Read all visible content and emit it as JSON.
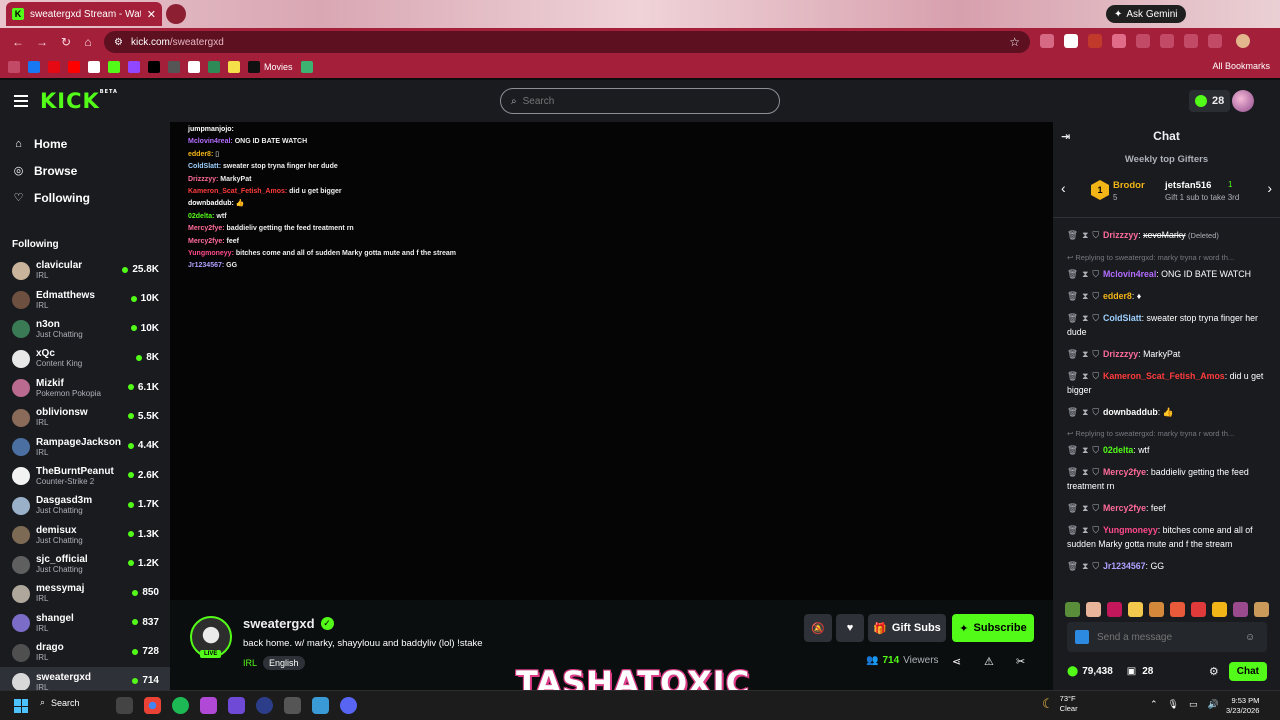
{
  "browser": {
    "tab_title": "sweatergxd Stream - Watch Live",
    "tab_close": "✕",
    "gemini_label": "Ask Gemini",
    "url_host": "kick.com",
    "url_path": "/sweatergxd",
    "bookmark_movies": "Movies",
    "all_bookmarks": "All Bookmarks"
  },
  "header": {
    "logo": "KICK",
    "logo_badge": "BETA",
    "search_placeholder": "Search",
    "kicks_count": "28"
  },
  "sidebar": {
    "nav": [
      {
        "label": "Home",
        "icon": "⌂"
      },
      {
        "label": "Browse",
        "icon": "◎"
      },
      {
        "label": "Following",
        "icon": "♡"
      }
    ],
    "following_title": "Following",
    "channels": [
      {
        "name": "clavicular",
        "category": "IRL",
        "viewers": "25.8K",
        "color": "#c9b39a"
      },
      {
        "name": "Edmatthews",
        "category": "IRL",
        "viewers": "10K",
        "color": "#6e5040"
      },
      {
        "name": "n3on",
        "category": "Just Chatting",
        "viewers": "10K",
        "color": "#3a7a55"
      },
      {
        "name": "xQc",
        "category": "Content King",
        "viewers": "8K",
        "color": "#e8e8e8"
      },
      {
        "name": "Mizkif",
        "category": "Pokemon Pokopia",
        "viewers": "6.1K",
        "color": "#b96a8e"
      },
      {
        "name": "oblivionsw",
        "category": "IRL",
        "viewers": "5.5K",
        "color": "#8a6b5a"
      },
      {
        "name": "RampageJackson",
        "category": "IRL",
        "viewers": "4.4K",
        "color": "#4a6fa0"
      },
      {
        "name": "TheBurntPeanut",
        "category": "Counter-Strike 2",
        "viewers": "2.6K",
        "color": "#f2f2f2"
      },
      {
        "name": "Dasgasd3m",
        "category": "Just Chatting",
        "viewers": "1.7K",
        "color": "#9ab0c8"
      },
      {
        "name": "demisux",
        "category": "Just Chatting",
        "viewers": "1.3K",
        "color": "#7d6a55"
      },
      {
        "name": "sjc_official",
        "category": "Just Chatting",
        "viewers": "1.2K",
        "color": "#5f5f5f"
      },
      {
        "name": "messymaj",
        "category": "IRL",
        "viewers": "850",
        "color": "#b0a79c"
      },
      {
        "name": "shangel",
        "category": "IRL",
        "viewers": "837",
        "color": "#7b6cc8"
      },
      {
        "name": "drago",
        "category": "IRL",
        "viewers": "728",
        "color": "#4f4f4f"
      },
      {
        "name": "sweatergxd",
        "category": "IRL",
        "viewers": "714",
        "color": "#d8d8d8"
      }
    ]
  },
  "overlay_chat": [
    {
      "user": "jumpmanjojo:",
      "text": "",
      "color": "#ffffff"
    },
    {
      "user": "Mclovin4real:",
      "text": " ONG ID BATE WATCH",
      "color": "#b36cff"
    },
    {
      "user": "edder8:",
      "text": " ▯",
      "color": "#f2b517"
    },
    {
      "user": "ColdSlatt:",
      "text": " sweater stop tryna finger her dude",
      "color": "#9fd0ff"
    },
    {
      "user": "Drizzzyy:",
      "text": " MarkyPat",
      "color": "#ff6b9a"
    },
    {
      "user": "Kameron_Scat_Fetish_Amos:",
      "text": " did u get bigger",
      "color": "#ff3b3b"
    },
    {
      "user": "downbaddub:",
      "text": " 👍",
      "color": "#ffffff"
    },
    {
      "user": "02delta:",
      "text": " wtf",
      "color": "#53fc18"
    },
    {
      "user": "Mercy2fye:",
      "text": " baddieliv getting the feed treatment rn",
      "color": "#ff6b9a"
    },
    {
      "user": "Mercy2fye:",
      "text": " feef",
      "color": "#ff6b9a"
    },
    {
      "user": "Yungmoneyy:",
      "text": " bitches come and all of sudden Marky gotta mute and f the stream",
      "color": "#ff4a8a"
    },
    {
      "user": "Jr1234567:",
      "text": " GG",
      "color": "#b0a0ff"
    }
  ],
  "stream": {
    "name": "sweatergxd",
    "live": "LIVE",
    "title": "back home. w/ marky, shayylouu and baddyliv (lol) !stake",
    "category": "IRL",
    "language": "English",
    "gift_label": "Gift Subs",
    "subscribe_label": "Subscribe",
    "viewers": "714",
    "viewers_label": "Viewers",
    "watermark": "TASHATOXIC"
  },
  "chat": {
    "title": "Chat",
    "gifters_title": "Weekly top Gifters",
    "gifter1": {
      "rank": "1",
      "name": "Brodor",
      "count": "5"
    },
    "gifter2": {
      "name": "jetsfan516",
      "count": "1",
      "sub": "Gift 1 sub to take 3rd"
    },
    "messages": [
      {
        "reply": "",
        "user": "Drizzzyy",
        "text": "xevoMarky",
        "deleted": true,
        "tag": "(Deleted)",
        "color": "#ff6b9a"
      },
      {
        "reply": "↩ Replying to sweatergxd: marky tryna r word th...",
        "user": "Mclovin4real",
        "text": "ONG ID BATE WATCH",
        "deleted": false,
        "tag": "",
        "color": "#b36cff"
      },
      {
        "reply": "",
        "user": "edder8",
        "text": "♦",
        "deleted": false,
        "tag": "",
        "color": "#f2b517"
      },
      {
        "reply": "",
        "user": "ColdSlatt",
        "text": "sweater stop tryna finger her dude",
        "deleted": false,
        "tag": "",
        "color": "#9fd0ff"
      },
      {
        "reply": "",
        "user": "Drizzzyy",
        "text": "MarkyPat",
        "deleted": false,
        "tag": "",
        "color": "#ff6b9a"
      },
      {
        "reply": "",
        "user": "Kameron_Scat_Fetish_Amos",
        "text": "did u get bigger",
        "deleted": false,
        "tag": "",
        "color": "#ff3b3b"
      },
      {
        "reply": "",
        "user": "downbaddub",
        "text": "👍",
        "deleted": false,
        "tag": "",
        "color": "#ffffff"
      },
      {
        "reply": "↩ Replying to sweatergxd: marky tryna r word th...",
        "user": "02delta",
        "text": "wtf",
        "deleted": false,
        "tag": "",
        "color": "#53fc18"
      },
      {
        "reply": "",
        "user": "Mercy2fye",
        "text": "baddieliv getting the feed treatment rn",
        "deleted": false,
        "tag": "",
        "color": "#ff6b9a"
      },
      {
        "reply": "",
        "user": "Mercy2fye",
        "text": "feef",
        "deleted": false,
        "tag": "",
        "color": "#ff6b9a"
      },
      {
        "reply": "",
        "user": "Yungmoneyy",
        "text": "bitches come and all of sudden Marky gotta mute and f the stream",
        "deleted": false,
        "tag": "",
        "color": "#ff4a8a"
      },
      {
        "reply": "",
        "user": "Jr1234567",
        "text": "GG",
        "deleted": false,
        "tag": "",
        "color": "#b0a0ff"
      }
    ],
    "input_placeholder": "Send a message",
    "points": "79,438",
    "gift_count": "28",
    "send_label": "Chat"
  },
  "taskbar": {
    "search_label": "Search",
    "temp": "73°F",
    "weather": "Clear",
    "time": "9:53 PM",
    "date": "3/23/2026"
  }
}
